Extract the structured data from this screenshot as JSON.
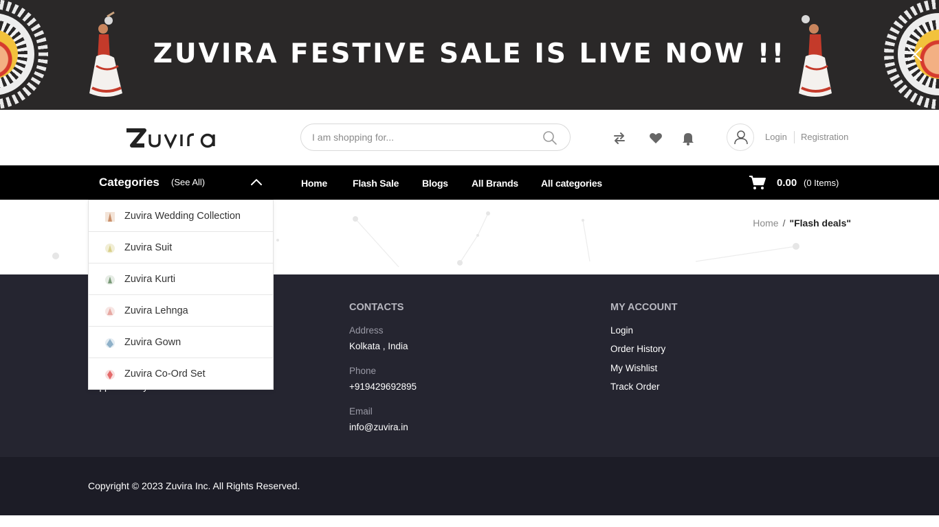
{
  "banner": {
    "title": "ZUVIRA FESTIVE SALE IS LIVE NOW !!"
  },
  "header": {
    "search_placeholder": "I am shopping for...",
    "login": "Login",
    "registration": "Registration"
  },
  "nav": {
    "categories_title": "Categories",
    "see_all": "(See All)",
    "links": [
      "Home",
      "Flash Sale",
      "Blogs",
      "All Brands",
      "All categories"
    ],
    "cart_total": "0.00",
    "cart_items": "(0 Items)"
  },
  "category_menu": {
    "items": [
      {
        "label": "Zuvira Wedding Collection",
        "icon": "wedding-thumb-icon",
        "color": "#c98f6a"
      },
      {
        "label": "Zuvira Suit",
        "icon": "suit-thumb-icon",
        "color": "#d9d08a"
      },
      {
        "label": "Zuvira Kurti",
        "icon": "kurti-thumb-icon",
        "color": "#7a9a78"
      },
      {
        "label": "Zuvira Lehnga",
        "icon": "lehnga-thumb-icon",
        "color": "#e7a9a3"
      },
      {
        "label": "Zuvira Gown",
        "icon": "gown-thumb-icon",
        "color": "#8fb1c9"
      },
      {
        "label": "Zuvira Co-Ord Set",
        "icon": "coord-thumb-icon",
        "color": "#e46a6a"
      }
    ]
  },
  "breadcrumb": {
    "home": "Home",
    "separator": "/",
    "current": "\"Flash deals\""
  },
  "footer": {
    "partial_link": "Support Policy",
    "contacts": {
      "title": "CONTACTS",
      "address_label": "Address",
      "address": "Kolkata , India",
      "phone_label": "Phone",
      "phone": "+919429692895",
      "email_label": "Email",
      "email": "info@zuvira.in"
    },
    "account": {
      "title": "MY ACCOUNT",
      "links": [
        "Login",
        "Order History",
        "My Wishlist",
        "Track Order"
      ]
    },
    "copyright": "Copyright ©  2023  Zuvira Inc. All Rights Reserved."
  },
  "colors": {
    "banner_bg": "#2a2828",
    "nav_bg": "#000000",
    "footer_bg": "#252530",
    "bottom_bg": "#1c1c26"
  }
}
